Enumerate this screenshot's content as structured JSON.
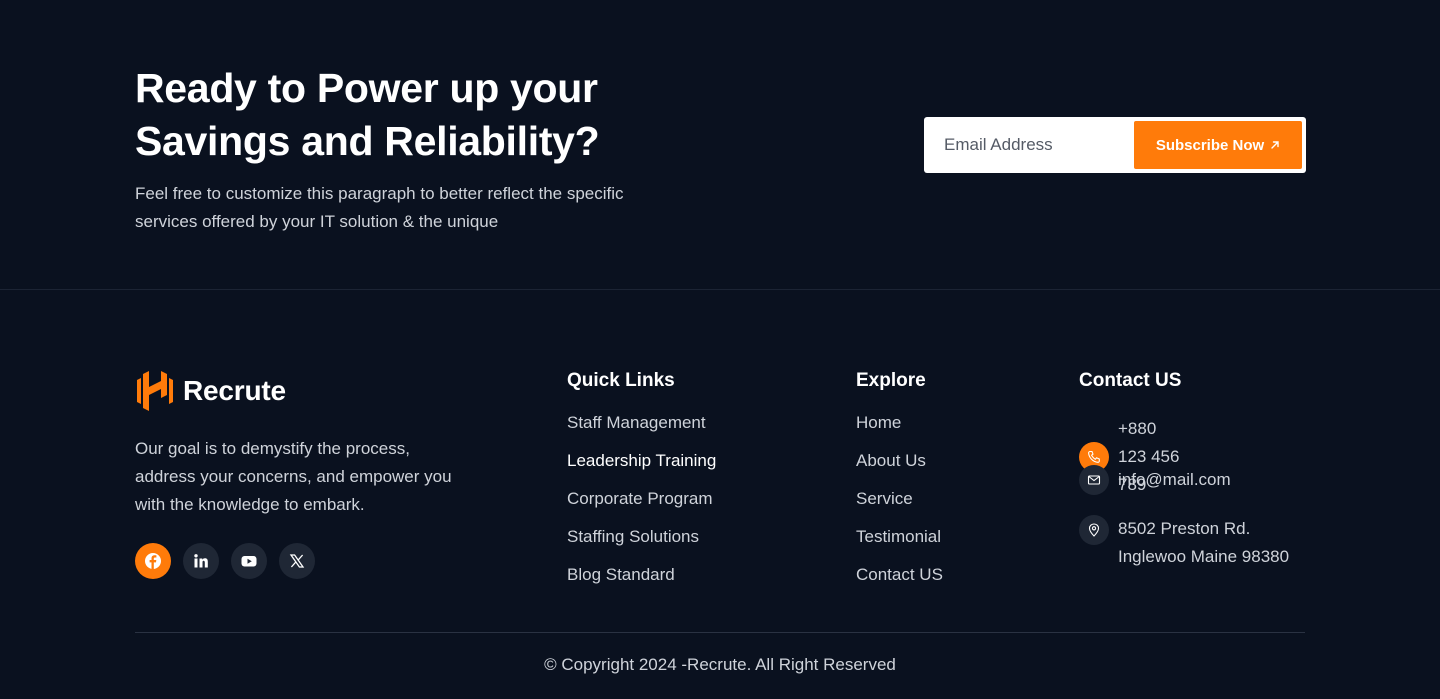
{
  "cta": {
    "title": "Ready to Power up your Savings and Reliability?",
    "text": "Feel free to customize this paragraph to better reflect the specific services offered by your IT solution & the unique",
    "email_placeholder": "Email Address",
    "subscribe_label": "Subscribe Now"
  },
  "brand": {
    "name": "Recrute",
    "about": "Our goal is to demystify the process, address your concerns, and empower you with the knowledge to embark.",
    "socials": [
      {
        "icon": "facebook-icon",
        "active": true
      },
      {
        "icon": "linkedin-icon",
        "active": false
      },
      {
        "icon": "youtube-icon",
        "active": false
      },
      {
        "icon": "x-icon",
        "active": false
      }
    ]
  },
  "quick_links": {
    "title": "Quick Links",
    "items": [
      "Staff Management",
      "Leadership Training",
      "Corporate Program",
      "Staffing Solutions",
      "Blog Standard"
    ]
  },
  "explore": {
    "title": "Explore",
    "items": [
      "Home",
      "About Us",
      "Service",
      "Testimonial",
      "Contact US"
    ]
  },
  "contact": {
    "title": "Contact US",
    "phone": "+880 123 456 789",
    "email": "info@mail.com",
    "address": "8502 Preston Rd. Inglewoo Maine 98380"
  },
  "copyright": "© Copyright 2024 -Recrute. All Right Reserved",
  "colors": {
    "accent": "#ff7b0a",
    "background": "#0a111f"
  }
}
